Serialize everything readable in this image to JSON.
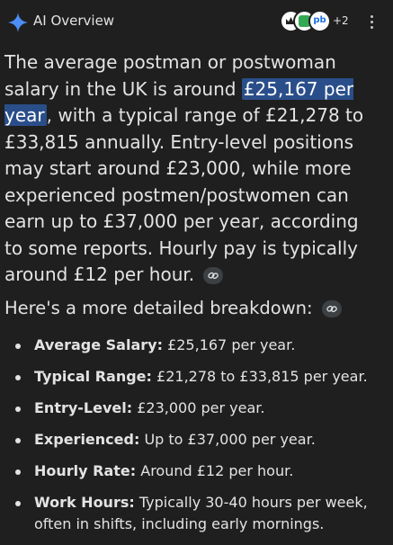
{
  "header": {
    "title": "AI Overview",
    "sources_more": "+2",
    "source_badge_3": "pb"
  },
  "summary": {
    "text_before": "The average postman or postwoman salary in the UK is around ",
    "highlight": "£25,167 per year",
    "text_after": ", with a typical range of £21,278 to £33,815 annually. Entry-level positions may start around £23,000, while more experienced postmen/postwomen can earn up to £37,000 per year, according to some reports. Hourly pay is typically around £12 per hour."
  },
  "breakdown": {
    "heading": "Here's a more detailed breakdown:",
    "items": [
      {
        "label": "Average Salary:",
        "value": " £25,167 per year."
      },
      {
        "label": "Typical Range:",
        "value": " £21,278 to £33,815 per year."
      },
      {
        "label": "Entry-Level:",
        "value": " £23,000 per year."
      },
      {
        "label": "Experienced:",
        "value": " Up to £37,000 per year."
      },
      {
        "label": "Hourly Rate:",
        "value": " Around £12 per hour."
      },
      {
        "label": "Work Hours:",
        "value": " Typically 30-40 hours per week, often in shifts, including early mornings."
      }
    ]
  },
  "icons": {
    "spark": "sparkle-icon",
    "more": "more-vert-icon",
    "link": "link-icon"
  },
  "colors": {
    "background": "#1f1f1f",
    "text": "#e3e3e3",
    "highlight": "#2a4e8a",
    "spark_blue": "#4c8df6"
  }
}
